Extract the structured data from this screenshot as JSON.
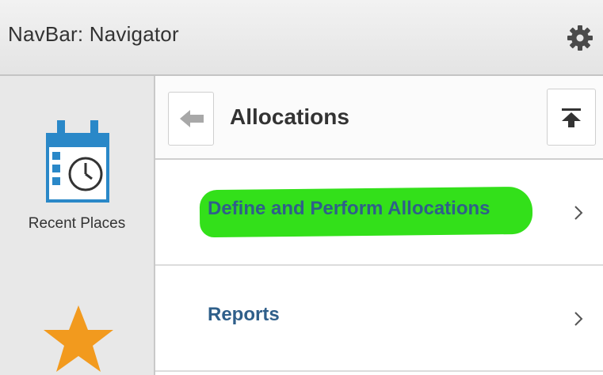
{
  "header": {
    "title": "NavBar: Navigator"
  },
  "sidebar": {
    "items": [
      {
        "label": "Recent Places",
        "icon": "calendar-clock-icon"
      },
      {
        "label": "",
        "icon": "star-icon"
      }
    ]
  },
  "main": {
    "title": "Allocations",
    "items": [
      {
        "label": "Define and Perform Allocations",
        "highlighted": true
      },
      {
        "label": "Reports",
        "highlighted": false
      }
    ]
  },
  "colors": {
    "link": "#2f5f8a",
    "highlight": "#33e01a",
    "calendar": "#2a88c8",
    "star": "#f29a1e"
  }
}
